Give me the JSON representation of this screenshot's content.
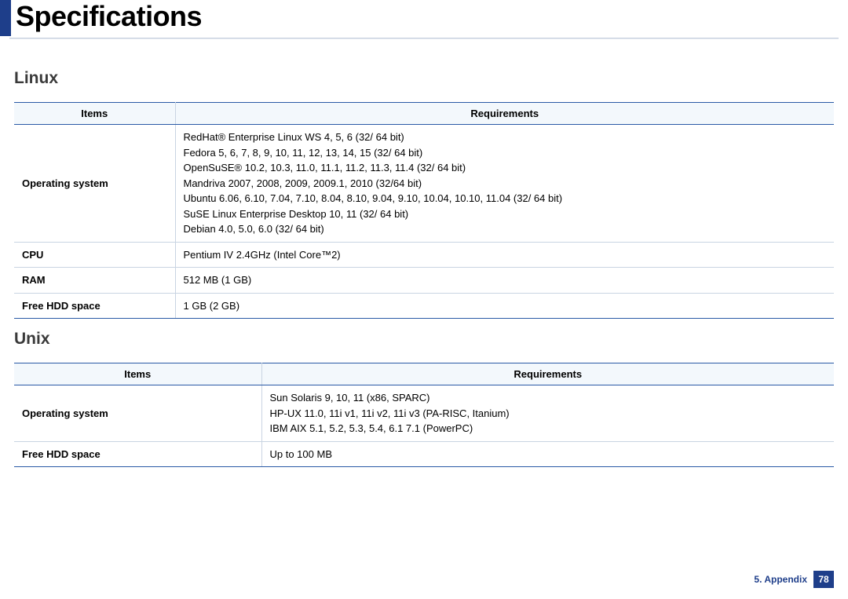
{
  "page_title": "Specifications",
  "sections": [
    {
      "title": "Linux",
      "headers": [
        "Items",
        "Requirements"
      ],
      "rows": [
        {
          "item": "Operating system",
          "req": [
            "RedHat® Enterprise Linux WS 4, 5, 6 (32/ 64 bit)",
            "Fedora 5, 6, 7, 8, 9, 10, 11, 12, 13, 14, 15 (32/ 64 bit)",
            "OpenSuSE® 10.2, 10.3, 11.0, 11.1, 11.2, 11.3, 11.4 (32/ 64 bit)",
            "Mandriva 2007, 2008, 2009, 2009.1, 2010 (32/64 bit)",
            "Ubuntu  6.06, 6.10, 7.04, 7.10, 8.04, 8.10, 9.04, 9.10, 10.04, 10.10, 11.04 (32/ 64 bit)",
            "SuSE Linux Enterprise Desktop 10, 11 (32/ 64 bit)",
            "Debian 4.0, 5.0, 6.0 (32/ 64 bit)"
          ]
        },
        {
          "item": "CPU",
          "req": [
            "Pentium IV 2.4GHz (Intel Core™2)"
          ]
        },
        {
          "item": "RAM",
          "req": [
            "512 MB (1 GB)"
          ]
        },
        {
          "item": "Free HDD space",
          "req": [
            "1 GB (2 GB)"
          ]
        }
      ]
    },
    {
      "title": "Unix",
      "headers": [
        "Items",
        "Requirements"
      ],
      "rows": [
        {
          "item": "Operating system",
          "req": [
            "Sun Solaris 9, 10, 11 (x86, SPARC)",
            "HP-UX 11.0, 11i v1, 11i v2, 11i v3 (PA-RISC, Itanium)",
            "IBM AIX 5.1, 5.2, 5.3, 5.4, 6.1 7.1 (PowerPC)"
          ]
        },
        {
          "item": "Free HDD space",
          "req": [
            "Up to 100 MB"
          ]
        }
      ]
    }
  ],
  "footer": {
    "section": "5. Appendix",
    "page": "78"
  }
}
